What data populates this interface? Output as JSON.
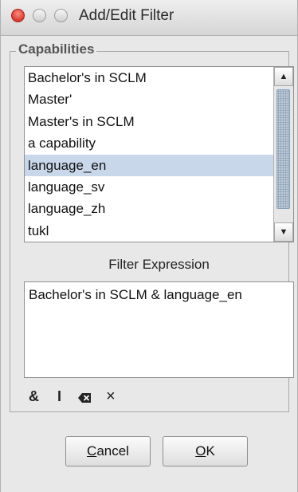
{
  "window": {
    "title": "Add/Edit Filter"
  },
  "capabilities": {
    "legend": "Capabilities",
    "items": [
      "Bachelor's in SCLM",
      "Master'",
      "Master's in SCLM",
      "a capability",
      "language_en",
      "language_sv",
      "language_zh",
      "tukl"
    ],
    "selected": "language_en"
  },
  "filter": {
    "label": "Filter Expression",
    "expression": "Bachelor's in SCLM & language_en"
  },
  "operators": {
    "and": "&",
    "or": "I",
    "backspace_icon": "backspace-icon",
    "clear": "×"
  },
  "buttons": {
    "cancel_mnemonic": "C",
    "cancel_rest": "ancel",
    "ok_mnemonic": "O",
    "ok_rest": "K"
  },
  "colors": {
    "selection": "#c8d8ea",
    "close_light": "#e0443a"
  }
}
